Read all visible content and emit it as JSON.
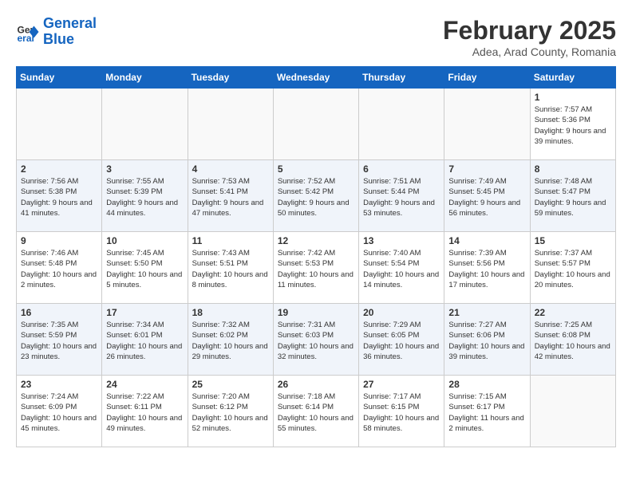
{
  "header": {
    "logo_line1": "General",
    "logo_line2": "Blue",
    "month_title": "February 2025",
    "subtitle": "Adea, Arad County, Romania"
  },
  "weekdays": [
    "Sunday",
    "Monday",
    "Tuesday",
    "Wednesday",
    "Thursday",
    "Friday",
    "Saturday"
  ],
  "weeks": [
    [
      {
        "day": "",
        "info": ""
      },
      {
        "day": "",
        "info": ""
      },
      {
        "day": "",
        "info": ""
      },
      {
        "day": "",
        "info": ""
      },
      {
        "day": "",
        "info": ""
      },
      {
        "day": "",
        "info": ""
      },
      {
        "day": "1",
        "info": "Sunrise: 7:57 AM\nSunset: 5:36 PM\nDaylight: 9 hours and 39 minutes."
      }
    ],
    [
      {
        "day": "2",
        "info": "Sunrise: 7:56 AM\nSunset: 5:38 PM\nDaylight: 9 hours and 41 minutes."
      },
      {
        "day": "3",
        "info": "Sunrise: 7:55 AM\nSunset: 5:39 PM\nDaylight: 9 hours and 44 minutes."
      },
      {
        "day": "4",
        "info": "Sunrise: 7:53 AM\nSunset: 5:41 PM\nDaylight: 9 hours and 47 minutes."
      },
      {
        "day": "5",
        "info": "Sunrise: 7:52 AM\nSunset: 5:42 PM\nDaylight: 9 hours and 50 minutes."
      },
      {
        "day": "6",
        "info": "Sunrise: 7:51 AM\nSunset: 5:44 PM\nDaylight: 9 hours and 53 minutes."
      },
      {
        "day": "7",
        "info": "Sunrise: 7:49 AM\nSunset: 5:45 PM\nDaylight: 9 hours and 56 minutes."
      },
      {
        "day": "8",
        "info": "Sunrise: 7:48 AM\nSunset: 5:47 PM\nDaylight: 9 hours and 59 minutes."
      }
    ],
    [
      {
        "day": "9",
        "info": "Sunrise: 7:46 AM\nSunset: 5:48 PM\nDaylight: 10 hours and 2 minutes."
      },
      {
        "day": "10",
        "info": "Sunrise: 7:45 AM\nSunset: 5:50 PM\nDaylight: 10 hours and 5 minutes."
      },
      {
        "day": "11",
        "info": "Sunrise: 7:43 AM\nSunset: 5:51 PM\nDaylight: 10 hours and 8 minutes."
      },
      {
        "day": "12",
        "info": "Sunrise: 7:42 AM\nSunset: 5:53 PM\nDaylight: 10 hours and 11 minutes."
      },
      {
        "day": "13",
        "info": "Sunrise: 7:40 AM\nSunset: 5:54 PM\nDaylight: 10 hours and 14 minutes."
      },
      {
        "day": "14",
        "info": "Sunrise: 7:39 AM\nSunset: 5:56 PM\nDaylight: 10 hours and 17 minutes."
      },
      {
        "day": "15",
        "info": "Sunrise: 7:37 AM\nSunset: 5:57 PM\nDaylight: 10 hours and 20 minutes."
      }
    ],
    [
      {
        "day": "16",
        "info": "Sunrise: 7:35 AM\nSunset: 5:59 PM\nDaylight: 10 hours and 23 minutes."
      },
      {
        "day": "17",
        "info": "Sunrise: 7:34 AM\nSunset: 6:01 PM\nDaylight: 10 hours and 26 minutes."
      },
      {
        "day": "18",
        "info": "Sunrise: 7:32 AM\nSunset: 6:02 PM\nDaylight: 10 hours and 29 minutes."
      },
      {
        "day": "19",
        "info": "Sunrise: 7:31 AM\nSunset: 6:03 PM\nDaylight: 10 hours and 32 minutes."
      },
      {
        "day": "20",
        "info": "Sunrise: 7:29 AM\nSunset: 6:05 PM\nDaylight: 10 hours and 36 minutes."
      },
      {
        "day": "21",
        "info": "Sunrise: 7:27 AM\nSunset: 6:06 PM\nDaylight: 10 hours and 39 minutes."
      },
      {
        "day": "22",
        "info": "Sunrise: 7:25 AM\nSunset: 6:08 PM\nDaylight: 10 hours and 42 minutes."
      }
    ],
    [
      {
        "day": "23",
        "info": "Sunrise: 7:24 AM\nSunset: 6:09 PM\nDaylight: 10 hours and 45 minutes."
      },
      {
        "day": "24",
        "info": "Sunrise: 7:22 AM\nSunset: 6:11 PM\nDaylight: 10 hours and 49 minutes."
      },
      {
        "day": "25",
        "info": "Sunrise: 7:20 AM\nSunset: 6:12 PM\nDaylight: 10 hours and 52 minutes."
      },
      {
        "day": "26",
        "info": "Sunrise: 7:18 AM\nSunset: 6:14 PM\nDaylight: 10 hours and 55 minutes."
      },
      {
        "day": "27",
        "info": "Sunrise: 7:17 AM\nSunset: 6:15 PM\nDaylight: 10 hours and 58 minutes."
      },
      {
        "day": "28",
        "info": "Sunrise: 7:15 AM\nSunset: 6:17 PM\nDaylight: 11 hours and 2 minutes."
      },
      {
        "day": "",
        "info": ""
      }
    ]
  ]
}
